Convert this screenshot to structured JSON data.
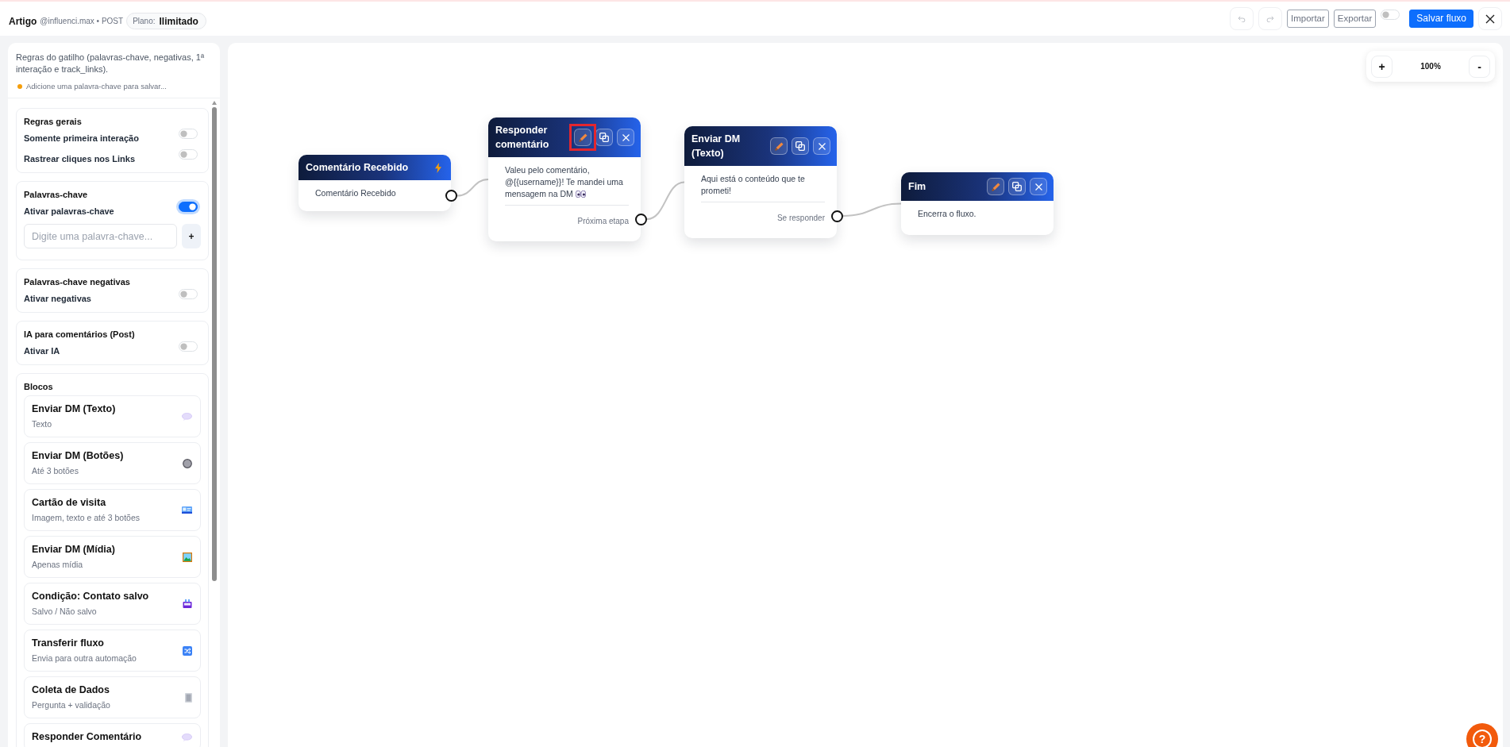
{
  "header": {
    "title": "Artigo",
    "subtitle": "@influenci.max • POST",
    "plan_label": "Plano:",
    "plan": "Ilimitado"
  },
  "toolbar": {
    "undo": {
      "disabled": true
    },
    "redo": {
      "disabled": true
    },
    "buttons": [
      {
        "label": "Importar"
      },
      {
        "label": "Exportar"
      }
    ],
    "toggle": {
      "on": false
    },
    "save": "Salvar fluxo"
  },
  "sidebar": {
    "description": "Regras do gatilho (palavras-chave, negativas, 1ª interação e track_links).",
    "warning": "Adicione uma palavra-chave para salvar...",
    "sections": [
      {
        "title": "Regras gerais",
        "toggles": [
          {
            "label": "Somente primeira interação",
            "on": false
          },
          {
            "label": "Rastrear cliques nos Links",
            "on": false
          }
        ]
      },
      {
        "title": "Palavras-chave",
        "toggles": [
          {
            "label": "Ativar palavras-chave",
            "on": true
          }
        ],
        "input": {
          "placeholder": "Digite uma palavra-chave...",
          "button": "+"
        }
      },
      {
        "title": "Palavras-chave negativas",
        "toggles": [
          {
            "label": "Ativar negativas",
            "on": false
          }
        ]
      },
      {
        "title": "IA para comentários (Post)",
        "toggles": [
          {
            "label": "Ativar IA",
            "on": false
          }
        ]
      }
    ],
    "blocks": {
      "title": "Blocos",
      "items": [
        {
          "kind": "dm_text",
          "title": "Enviar DM (Texto)",
          "subtitle": "Texto"
        },
        {
          "kind": "dm_buttons",
          "title": "Enviar DM (Botões)",
          "subtitle": "Até 3 botões"
        },
        {
          "kind": "business_card",
          "title": "Cartão de visita",
          "subtitle": "Imagem, texto e até 3 botões"
        },
        {
          "kind": "dm_media",
          "title": "Enviar DM (Mídia)",
          "subtitle": "Apenas mídia"
        },
        {
          "kind": "condition",
          "title": "Condição: Contato salvo",
          "subtitle": "Salvo / Não salvo"
        },
        {
          "kind": "transfer",
          "title": "Transferir fluxo",
          "subtitle": "Envia para outra automação"
        },
        {
          "kind": "data_collection",
          "title": "Coleta de Dados",
          "subtitle": "Pergunta + validação"
        },
        {
          "kind": "reply_comment",
          "title": "Responder Comentário"
        }
      ]
    }
  },
  "canvas": {
    "zoom": {
      "zoom_in": "+",
      "value": "100%",
      "zoom_out": "-"
    },
    "nodes": [
      {
        "kind": "trigger",
        "title": "Comentário Recebido",
        "body": "Comentário Recebido",
        "trailing_emoji": false
      },
      {
        "kind": "message",
        "title": "Responder comentário",
        "body": "Valeu pelo comentário, @{{username}}! Te mandei uma mensagem na DM",
        "trailing_emoji": true,
        "footer": "Próxima etapa",
        "actions": [
          {
            "kind": "edit",
            "highlighted": true
          },
          {
            "kind": "duplicate",
            "highlighted": false
          },
          {
            "kind": "delete",
            "highlighted": false
          }
        ]
      },
      {
        "kind": "message",
        "title": "Enviar DM (Texto)",
        "body": "Aqui está o conteúdo que te prometi!",
        "trailing_emoji": false,
        "footer": "Se responder",
        "actions": [
          {
            "kind": "edit",
            "highlighted": false
          },
          {
            "kind": "duplicate",
            "highlighted": false
          },
          {
            "kind": "delete",
            "highlighted": false
          }
        ]
      },
      {
        "kind": "end",
        "title": "Fim",
        "body": "Encerra o fluxo.",
        "trailing_emoji": false,
        "actions": [
          {
            "kind": "edit",
            "highlighted": false
          },
          {
            "kind": "duplicate",
            "highlighted": false
          },
          {
            "kind": "delete",
            "highlighted": false
          }
        ]
      }
    ],
    "help": {
      "label": "?"
    }
  }
}
